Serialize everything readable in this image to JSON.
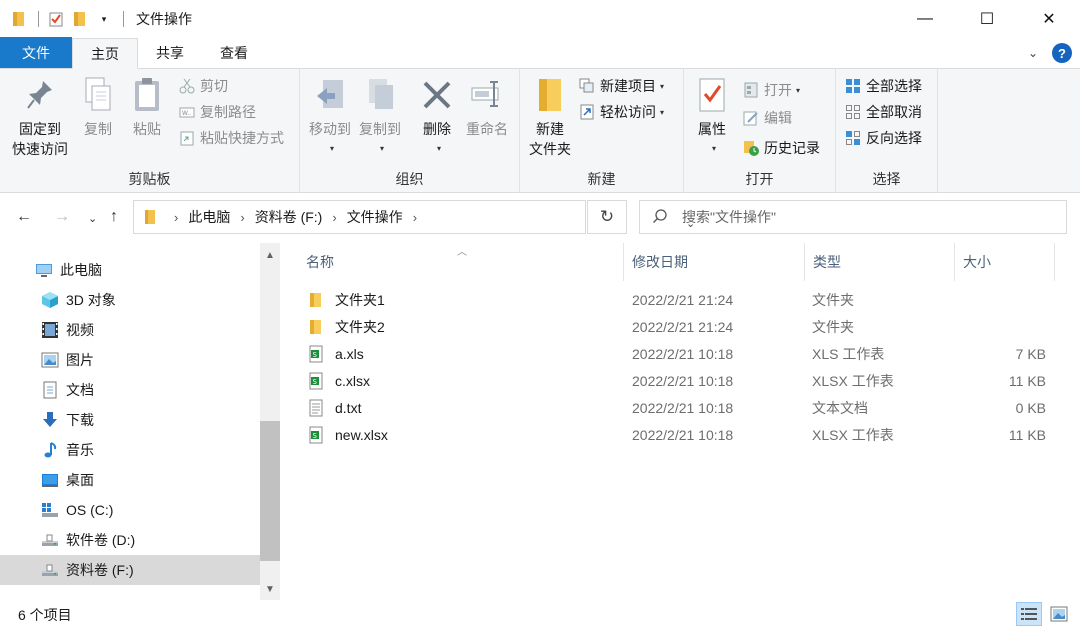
{
  "window": {
    "title": "文件操作",
    "minimize": "—",
    "maximize": "☐",
    "close": "✕"
  },
  "ribbon_tabs": {
    "file": "文件",
    "home": "主页",
    "share": "共享",
    "view": "查看"
  },
  "ribbon": {
    "clipboard": {
      "label": "剪贴板",
      "pin_line1": "固定到",
      "pin_line2": "快速访问",
      "copy": "复制",
      "paste": "粘贴",
      "cut": "剪切",
      "copy_path": "复制路径",
      "paste_shortcut": "粘贴快捷方式"
    },
    "organize": {
      "label": "组织",
      "move_to": "移动到",
      "copy_to": "复制到",
      "delete": "删除",
      "rename": "重命名"
    },
    "new": {
      "label": "新建",
      "new_folder_line1": "新建",
      "new_folder_line2": "文件夹",
      "new_item": "新建项目",
      "easy_access": "轻松访问"
    },
    "open": {
      "label": "打开",
      "properties": "属性",
      "open": "打开",
      "edit": "编辑",
      "history": "历史记录"
    },
    "select": {
      "label": "选择",
      "select_all": "全部选择",
      "select_none": "全部取消",
      "invert": "反向选择"
    }
  },
  "address": {
    "crumbs": [
      "此电脑",
      "资料卷 (F:)",
      "文件操作"
    ],
    "search_placeholder": "搜索\"文件操作\""
  },
  "nav_pane": {
    "items": [
      {
        "label": "此电脑",
        "icon": "computer-icon"
      },
      {
        "label": "3D 对象",
        "icon": "3d-objects-icon"
      },
      {
        "label": "视频",
        "icon": "video-icon"
      },
      {
        "label": "图片",
        "icon": "pictures-icon"
      },
      {
        "label": "文档",
        "icon": "documents-icon"
      },
      {
        "label": "下载",
        "icon": "download-icon"
      },
      {
        "label": "音乐",
        "icon": "music-icon"
      },
      {
        "label": "桌面",
        "icon": "desktop-icon"
      },
      {
        "label": "OS (C:)",
        "icon": "windows-drive-icon"
      },
      {
        "label": "软件卷 (D:)",
        "icon": "drive-icon"
      },
      {
        "label": "资料卷 (F:)",
        "icon": "drive-icon"
      }
    ]
  },
  "file_list": {
    "columns": {
      "name": "名称",
      "modified": "修改日期",
      "type": "类型",
      "size": "大小"
    },
    "rows": [
      {
        "name": "文件夹1",
        "modified": "2022/2/21 21:24",
        "type": "文件夹",
        "size": "",
        "icon": "folder-icon"
      },
      {
        "name": "文件夹2",
        "modified": "2022/2/21 21:24",
        "type": "文件夹",
        "size": "",
        "icon": "folder-icon"
      },
      {
        "name": "a.xls",
        "modified": "2022/2/21 10:18",
        "type": "XLS 工作表",
        "size": "7 KB",
        "icon": "spreadsheet-icon"
      },
      {
        "name": "c.xlsx",
        "modified": "2022/2/21 10:18",
        "type": "XLSX 工作表",
        "size": "11 KB",
        "icon": "spreadsheet-icon"
      },
      {
        "name": "d.txt",
        "modified": "2022/2/21 10:18",
        "type": "文本文档",
        "size": "0 KB",
        "icon": "text-file-icon"
      },
      {
        "name": "new.xlsx",
        "modified": "2022/2/21 10:18",
        "type": "XLSX 工作表",
        "size": "11 KB",
        "icon": "spreadsheet-icon"
      }
    ]
  },
  "status": {
    "item_count": "6 个项目"
  },
  "colors": {
    "file_tab": "#1979ca",
    "folder": "#f2c14e",
    "spreadsheet": "#1d8f3a",
    "selected": "#d9d9d9"
  }
}
